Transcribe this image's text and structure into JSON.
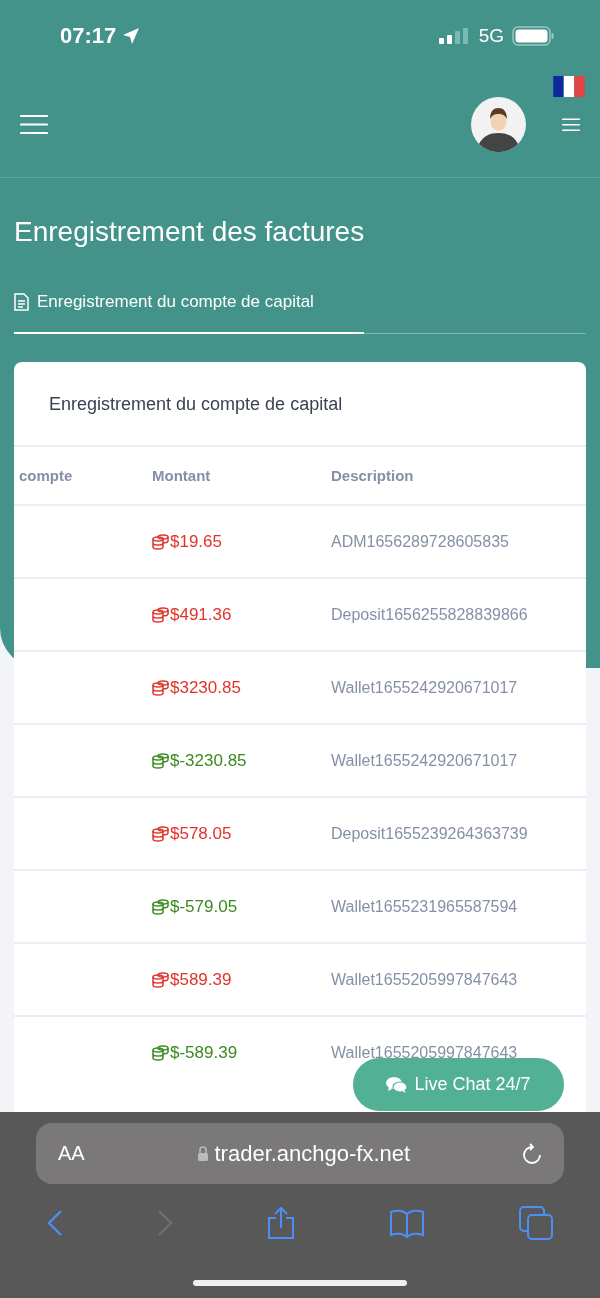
{
  "status_bar": {
    "time": "07:17",
    "network": "5G"
  },
  "page": {
    "title": "Enregistrement des factures",
    "tab": {
      "label": "Enregistrement du compte de capital",
      "selected": true
    }
  },
  "card": {
    "title": "Enregistrement du compte de capital",
    "columns": [
      "compte",
      "Montant",
      "Description"
    ],
    "rows": [
      {
        "amount": "$19.65",
        "color": "#e0342a",
        "description": "ADM1656289728605835"
      },
      {
        "amount": "$491.36",
        "color": "#e0342a",
        "description": "Deposit1656255828839866"
      },
      {
        "amount": "$3230.85",
        "color": "#e0342a",
        "description": "Wallet1655242920671017"
      },
      {
        "amount": "$-3230.85",
        "color": "#3b8a1f",
        "description": "Wallet1655242920671017"
      },
      {
        "amount": "$578.05",
        "color": "#e0342a",
        "description": "Deposit1655239264363739"
      },
      {
        "amount": "$-579.05",
        "color": "#3b8a1f",
        "description": "Wallet1655231965587594"
      },
      {
        "amount": "$589.39",
        "color": "#e0342a",
        "description": "Wallet1655205997847643"
      },
      {
        "amount": "$-589.39",
        "color": "#3b8a1f",
        "description": "Wallet1655205997847643"
      }
    ]
  },
  "live_chat": {
    "label": "Live Chat 24/7"
  },
  "browser": {
    "text_size": "AA",
    "url": "trader.anchgo-fx.net"
  }
}
